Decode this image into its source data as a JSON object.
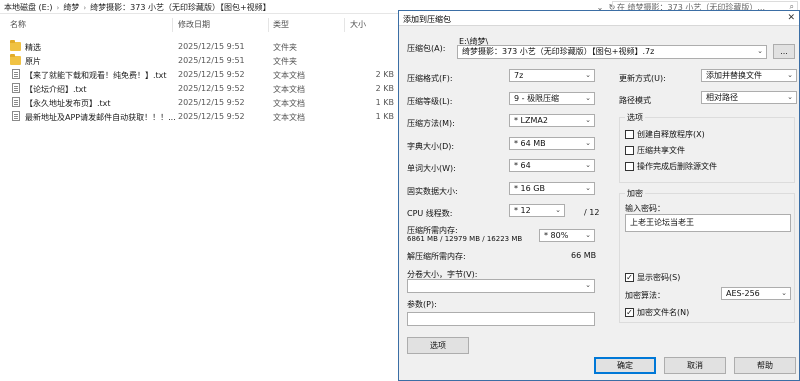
{
  "explorer": {
    "breadcrumb": [
      "本地磁盘 (E:)",
      "绮梦",
      "绮梦摄影：373 小艺（无印珍藏版）【图包+视频】"
    ],
    "search_placeholder": "在 绮梦摄影：373 小艺（无印珍藏版）...",
    "columns": {
      "name": "名称",
      "date": "修改日期",
      "type": "类型",
      "size": "大小"
    },
    "rows": [
      {
        "icon": "folder",
        "name": "精选",
        "date": "2025/12/15 9:51",
        "type": "文件夹",
        "size": ""
      },
      {
        "icon": "folder",
        "name": "原片",
        "date": "2025/12/15 9:51",
        "type": "文件夹",
        "size": ""
      },
      {
        "icon": "file",
        "name": "【来了就能下载和观看！纯免费！】.txt",
        "date": "2025/12/15 9:52",
        "type": "文本文档",
        "size": "2 KB"
      },
      {
        "icon": "file",
        "name": "【论坛介绍】.txt",
        "date": "2025/12/15 9:52",
        "type": "文本文档",
        "size": "2 KB"
      },
      {
        "icon": "file",
        "name": "【永久地址发布页】.txt",
        "date": "2025/12/15 9:52",
        "type": "文本文档",
        "size": "1 KB"
      },
      {
        "icon": "file",
        "name": "最新地址及APP请发邮件自动获取！！！...",
        "date": "2025/12/15 9:52",
        "type": "文本文档",
        "size": "1 KB"
      }
    ]
  },
  "dialog": {
    "title": "添加到压缩包",
    "close_label": "✕",
    "archive": {
      "label": "压缩包(A):",
      "path": "E:\\绮梦\\",
      "filename": "绮梦摄影：373 小艺（无印珍藏版）【图包+视频】.7z",
      "browse_label": "..."
    },
    "format": {
      "label": "压缩格式(F):",
      "value": "7z"
    },
    "level": {
      "label": "压缩等级(L):",
      "value": "9 - 极限压缩"
    },
    "method": {
      "label": "压缩方法(M):",
      "value": "* LZMA2"
    },
    "dictionary": {
      "label": "字典大小(D):",
      "value": "* 64 MB"
    },
    "word": {
      "label": "单词大小(W):",
      "value": "* 64"
    },
    "solid": {
      "label": "固实数据大小:",
      "value": "* 16 GB"
    },
    "threads": {
      "label": "CPU 线程数:",
      "value": "* 12",
      "max": "/ 12"
    },
    "memory": {
      "label": "压缩所需内存:",
      "detail": "6861 MB / 12979 MB / 16223 MB",
      "percent": "* 80%"
    },
    "decompress_memory": {
      "label": "解压缩所需内存:",
      "value": "66 MB"
    },
    "split": {
      "label": "分卷大小，字节(V):",
      "value": ""
    },
    "params": {
      "label": "参数(P):",
      "value": ""
    },
    "options_button": "选项",
    "update_mode": {
      "label": "更新方式(U):",
      "value": "添加并替换文件"
    },
    "path_mode": {
      "label": "路径模式",
      "value": "相对路径"
    },
    "options_group": {
      "title": "选项",
      "items": [
        {
          "label": "创建自释放程序(X)",
          "checked": false
        },
        {
          "label": "压缩共享文件",
          "checked": false
        },
        {
          "label": "操作完成后删除源文件",
          "checked": false
        }
      ]
    },
    "encryption": {
      "title": "加密",
      "password_label": "输入密码：",
      "password_value": "上老王论坛当老王",
      "show_password": {
        "label": "显示密码(S)",
        "checked": true
      },
      "method_label": "加密算法：",
      "method_value": "AES-256",
      "encrypt_names": {
        "label": "加密文件名(N)",
        "checked": true
      }
    },
    "buttons": {
      "ok": "确定",
      "cancel": "取消",
      "help": "帮助"
    }
  }
}
